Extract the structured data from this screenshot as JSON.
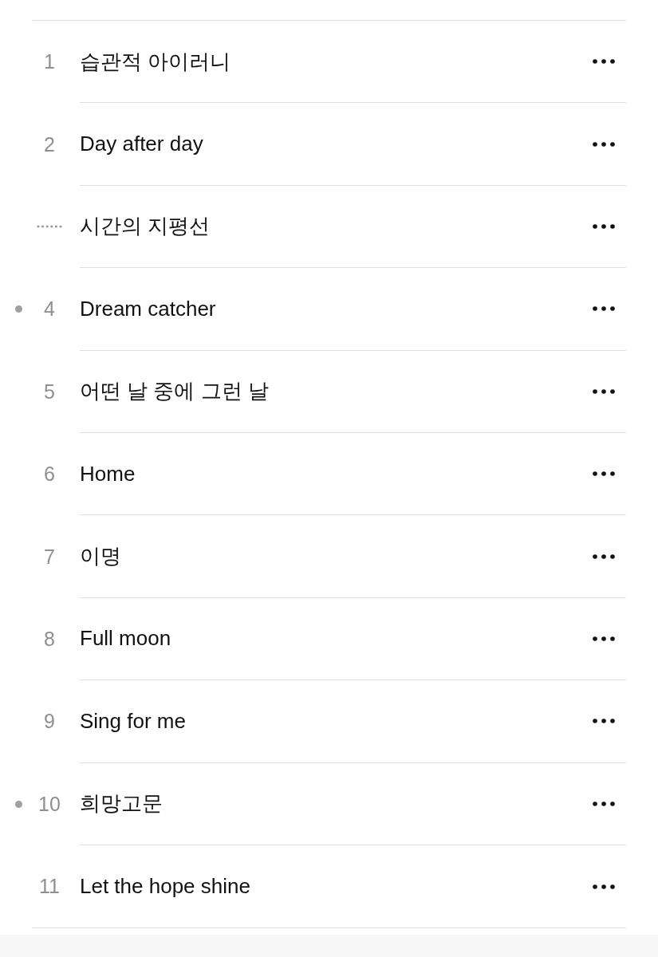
{
  "tracks": [
    {
      "number": "1",
      "title": "습관적 아이러니",
      "playing": false,
      "marked": false
    },
    {
      "number": "2",
      "title": "Day after day",
      "playing": false,
      "marked": false
    },
    {
      "title": "시간의 지평선",
      "playing": true,
      "marked": false
    },
    {
      "number": "4",
      "title": "Dream catcher",
      "playing": false,
      "marked": true
    },
    {
      "number": "5",
      "title": "어떤 날 중에 그런 날",
      "playing": false,
      "marked": false
    },
    {
      "number": "6",
      "title": "Home",
      "playing": false,
      "marked": false
    },
    {
      "number": "7",
      "title": "이명",
      "playing": false,
      "marked": false
    },
    {
      "number": "8",
      "title": "Full moon",
      "playing": false,
      "marked": false
    },
    {
      "number": "9",
      "title": "Sing for me",
      "playing": false,
      "marked": false
    },
    {
      "number": "10",
      "title": "희망고문",
      "playing": false,
      "marked": true
    },
    {
      "number": "11",
      "title": "Let the hope shine",
      "playing": false,
      "marked": false
    }
  ]
}
